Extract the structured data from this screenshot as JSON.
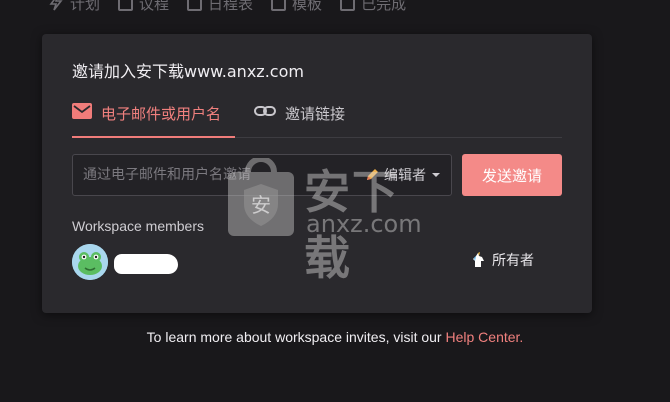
{
  "top_tabs": [
    {
      "label": "计划",
      "icon": "bolt-icon"
    },
    {
      "label": "议程",
      "icon": "agenda-icon"
    },
    {
      "label": "日程表",
      "icon": "calendar-icon"
    },
    {
      "label": "模板",
      "icon": "template-icon"
    },
    {
      "label": "已完成",
      "icon": "check-box-icon"
    }
  ],
  "modal": {
    "title": "邀请加入安下载www.anxz.com",
    "tabs": [
      {
        "label": "电子邮件或用户名",
        "icon": "mail-icon",
        "active": true
      },
      {
        "label": "邀请链接",
        "icon": "link-icon",
        "active": false
      }
    ],
    "invite": {
      "placeholder": "通过电子邮件和用户名邀请",
      "value": "",
      "role": {
        "label": "编辑者",
        "icon": "pencil-icon"
      },
      "send_label": "发送邀请"
    },
    "members_label": "Workspace members",
    "members": [
      {
        "name": "",
        "role": {
          "label": "所有者",
          "icon": "unicorn-icon"
        }
      }
    ]
  },
  "footer": {
    "text": "To learn more about workspace invites, visit our",
    "link": "Help Center."
  },
  "watermark": {
    "text": "安下载",
    "url": "anxz.com"
  },
  "colors": {
    "accent": "#f07c7a",
    "button": "#f48a88",
    "modal_bg": "#2a292d",
    "page_bg": "#19181b"
  }
}
